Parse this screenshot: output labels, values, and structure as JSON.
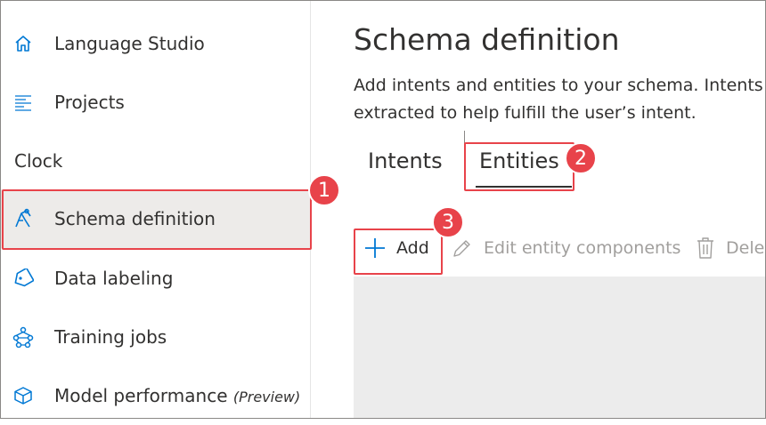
{
  "sidebar": {
    "items": [
      {
        "label": "Language Studio",
        "icon": "home-icon"
      },
      {
        "label": "Projects",
        "icon": "list-icon"
      }
    ],
    "section_label": "Clock",
    "project_items": [
      {
        "label": "Schema definition",
        "icon": "schema-icon",
        "selected": true
      },
      {
        "label": "Data labeling",
        "icon": "tag-icon"
      },
      {
        "label": "Training jobs",
        "icon": "network-icon"
      },
      {
        "label": "Model performance",
        "suffix": "(Preview)",
        "icon": "cube-icon"
      }
    ]
  },
  "main": {
    "title": "Schema definition",
    "description_line1": "Add intents and entities to your schema. Intents a",
    "description_line2": "extracted to help fulfill the user’s intent.",
    "tabs": [
      {
        "label": "Intents"
      },
      {
        "label": "Entities",
        "active": true
      }
    ],
    "toolbar": {
      "add_label": "Add",
      "edit_label": "Edit entity components",
      "delete_label": "Dele"
    }
  },
  "callouts": [
    "1",
    "2",
    "3"
  ],
  "colors": {
    "callout": "#e8434a",
    "accent": "#0078d4",
    "selected_bg": "#edebe9"
  }
}
